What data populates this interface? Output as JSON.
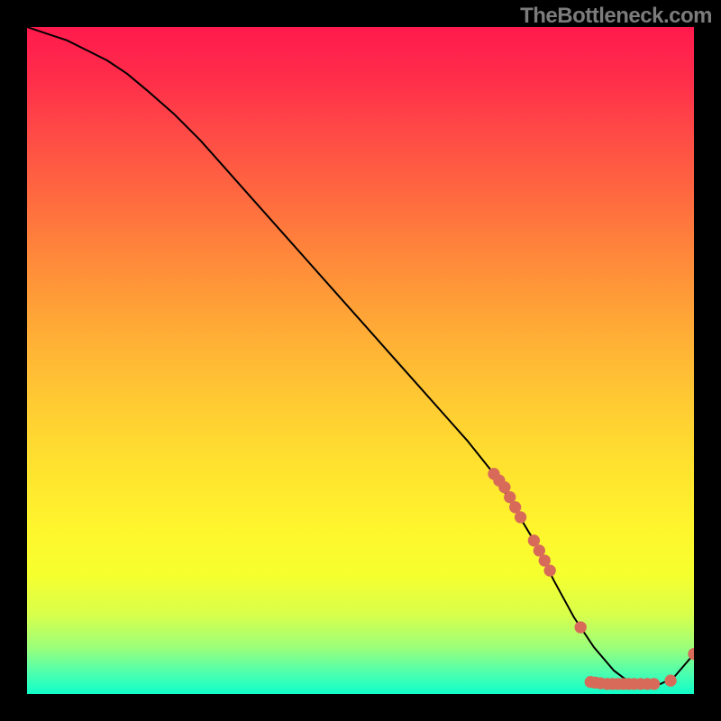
{
  "attribution": "TheBottleneck.com",
  "chart_data": {
    "type": "line",
    "title": "",
    "xlabel": "",
    "ylabel": "",
    "xlim": [
      0,
      100
    ],
    "ylim": [
      0,
      100
    ],
    "grid": false,
    "legend": false,
    "series": [
      {
        "name": "curve",
        "x": [
          0,
          3,
          6,
          9,
          12,
          15,
          18,
          22,
          26,
          30,
          34,
          38,
          42,
          46,
          50,
          54,
          58,
          62,
          66,
          70,
          73,
          76,
          79,
          82,
          85,
          88,
          90,
          92,
          95,
          97,
          100
        ],
        "y": [
          100,
          99,
          98,
          96.5,
          95,
          93,
          90.5,
          87,
          83,
          78.5,
          74,
          69.5,
          65,
          60.5,
          56,
          51.5,
          47,
          42.5,
          38,
          33,
          28,
          23,
          17,
          11.5,
          7,
          3.5,
          2,
          1.5,
          1.5,
          2.5,
          6
        ]
      }
    ],
    "markers": [
      {
        "x": 70.0,
        "y": 33.0
      },
      {
        "x": 70.8,
        "y": 32.0
      },
      {
        "x": 71.6,
        "y": 31.0
      },
      {
        "x": 72.4,
        "y": 29.5
      },
      {
        "x": 73.2,
        "y": 28.0
      },
      {
        "x": 74.0,
        "y": 26.5
      },
      {
        "x": 76.0,
        "y": 23.0
      },
      {
        "x": 76.8,
        "y": 21.5
      },
      {
        "x": 77.6,
        "y": 20.0
      },
      {
        "x": 78.4,
        "y": 18.5
      },
      {
        "x": 83.0,
        "y": 10.0
      },
      {
        "x": 84.5,
        "y": 1.8
      },
      {
        "x": 85.2,
        "y": 1.7
      },
      {
        "x": 86.0,
        "y": 1.6
      },
      {
        "x": 87.0,
        "y": 1.5
      },
      {
        "x": 87.8,
        "y": 1.5
      },
      {
        "x": 88.6,
        "y": 1.5
      },
      {
        "x": 89.4,
        "y": 1.5
      },
      {
        "x": 90.2,
        "y": 1.5
      },
      {
        "x": 91.0,
        "y": 1.5
      },
      {
        "x": 92.0,
        "y": 1.5
      },
      {
        "x": 93.0,
        "y": 1.5
      },
      {
        "x": 94.0,
        "y": 1.5
      },
      {
        "x": 96.5,
        "y": 2.0
      },
      {
        "x": 100.0,
        "y": 6.0
      }
    ],
    "colors": {
      "curve": "#000000",
      "markers": "#d86a5a"
    }
  }
}
